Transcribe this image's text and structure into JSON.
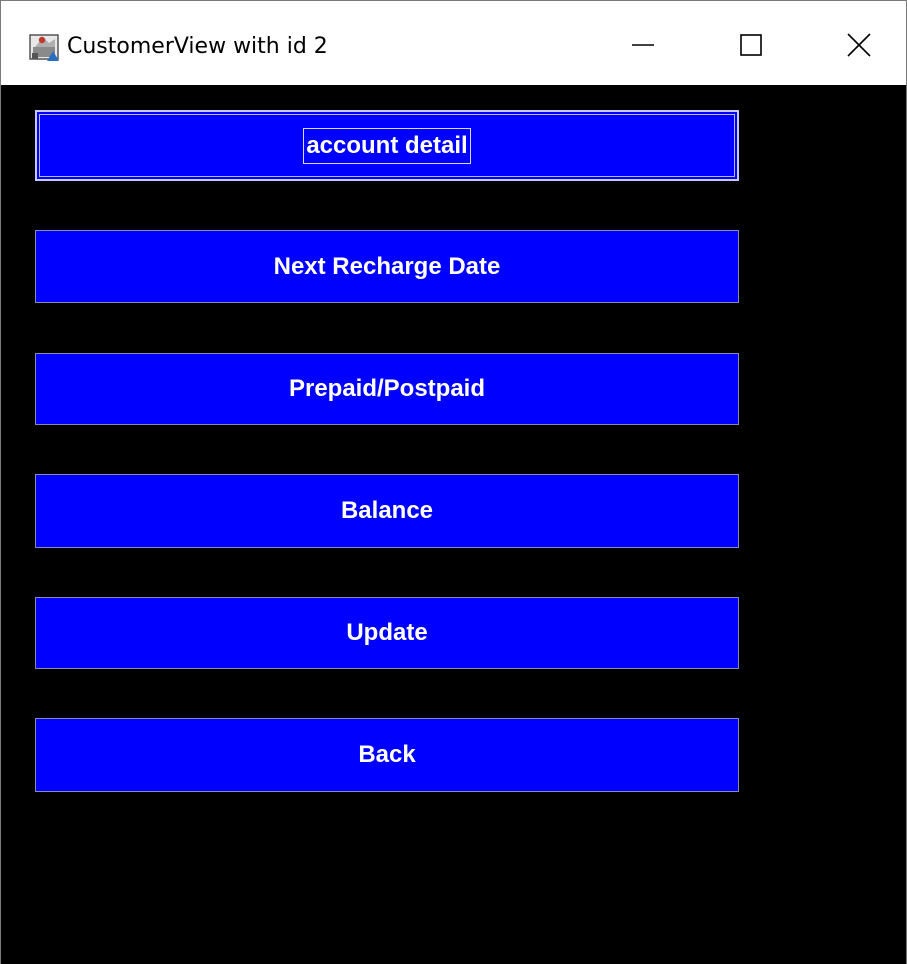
{
  "window": {
    "title": "CustomerView with id 2",
    "icon": "java-app-icon",
    "controls": {
      "minimize_icon": "minimize-icon",
      "maximize_icon": "maximize-icon",
      "close_icon": "close-icon"
    }
  },
  "colors": {
    "client_background": "#000000",
    "button_background": "#0000ff",
    "button_text": "#ffffff",
    "titlebar_background": "#ffffff"
  },
  "buttons": {
    "account_detail": "account detail",
    "next_recharge_date": "Next Recharge Date",
    "prepaid_postpaid": "Prepaid/Postpaid",
    "balance": "Balance",
    "update": "Update",
    "back": "Back"
  },
  "focused_button": "account detail"
}
